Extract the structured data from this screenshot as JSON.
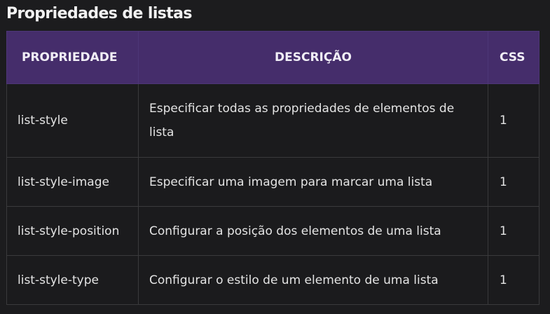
{
  "page_title": "Propriedades de listas",
  "table": {
    "headers": [
      "PROPRIEDADE",
      "DESCRIÇÃO",
      "CSS"
    ],
    "rows": [
      {
        "property": "list-style",
        "description": "Especificar todas as propriedades de elementos de lista",
        "css": "1"
      },
      {
        "property": "list-style-image",
        "description": "Especificar uma imagem para marcar uma lista",
        "css": "1"
      },
      {
        "property": "list-style-position",
        "description": "Configurar a posição dos elementos de uma lista",
        "css": "1"
      },
      {
        "property": "list-style-type",
        "description": "Configurar o estilo de um elemento de uma lista",
        "css": "1"
      }
    ]
  },
  "colors": {
    "background": "#1c1c1e",
    "header_background": "#452d6b",
    "border": "#3a3a3c"
  }
}
